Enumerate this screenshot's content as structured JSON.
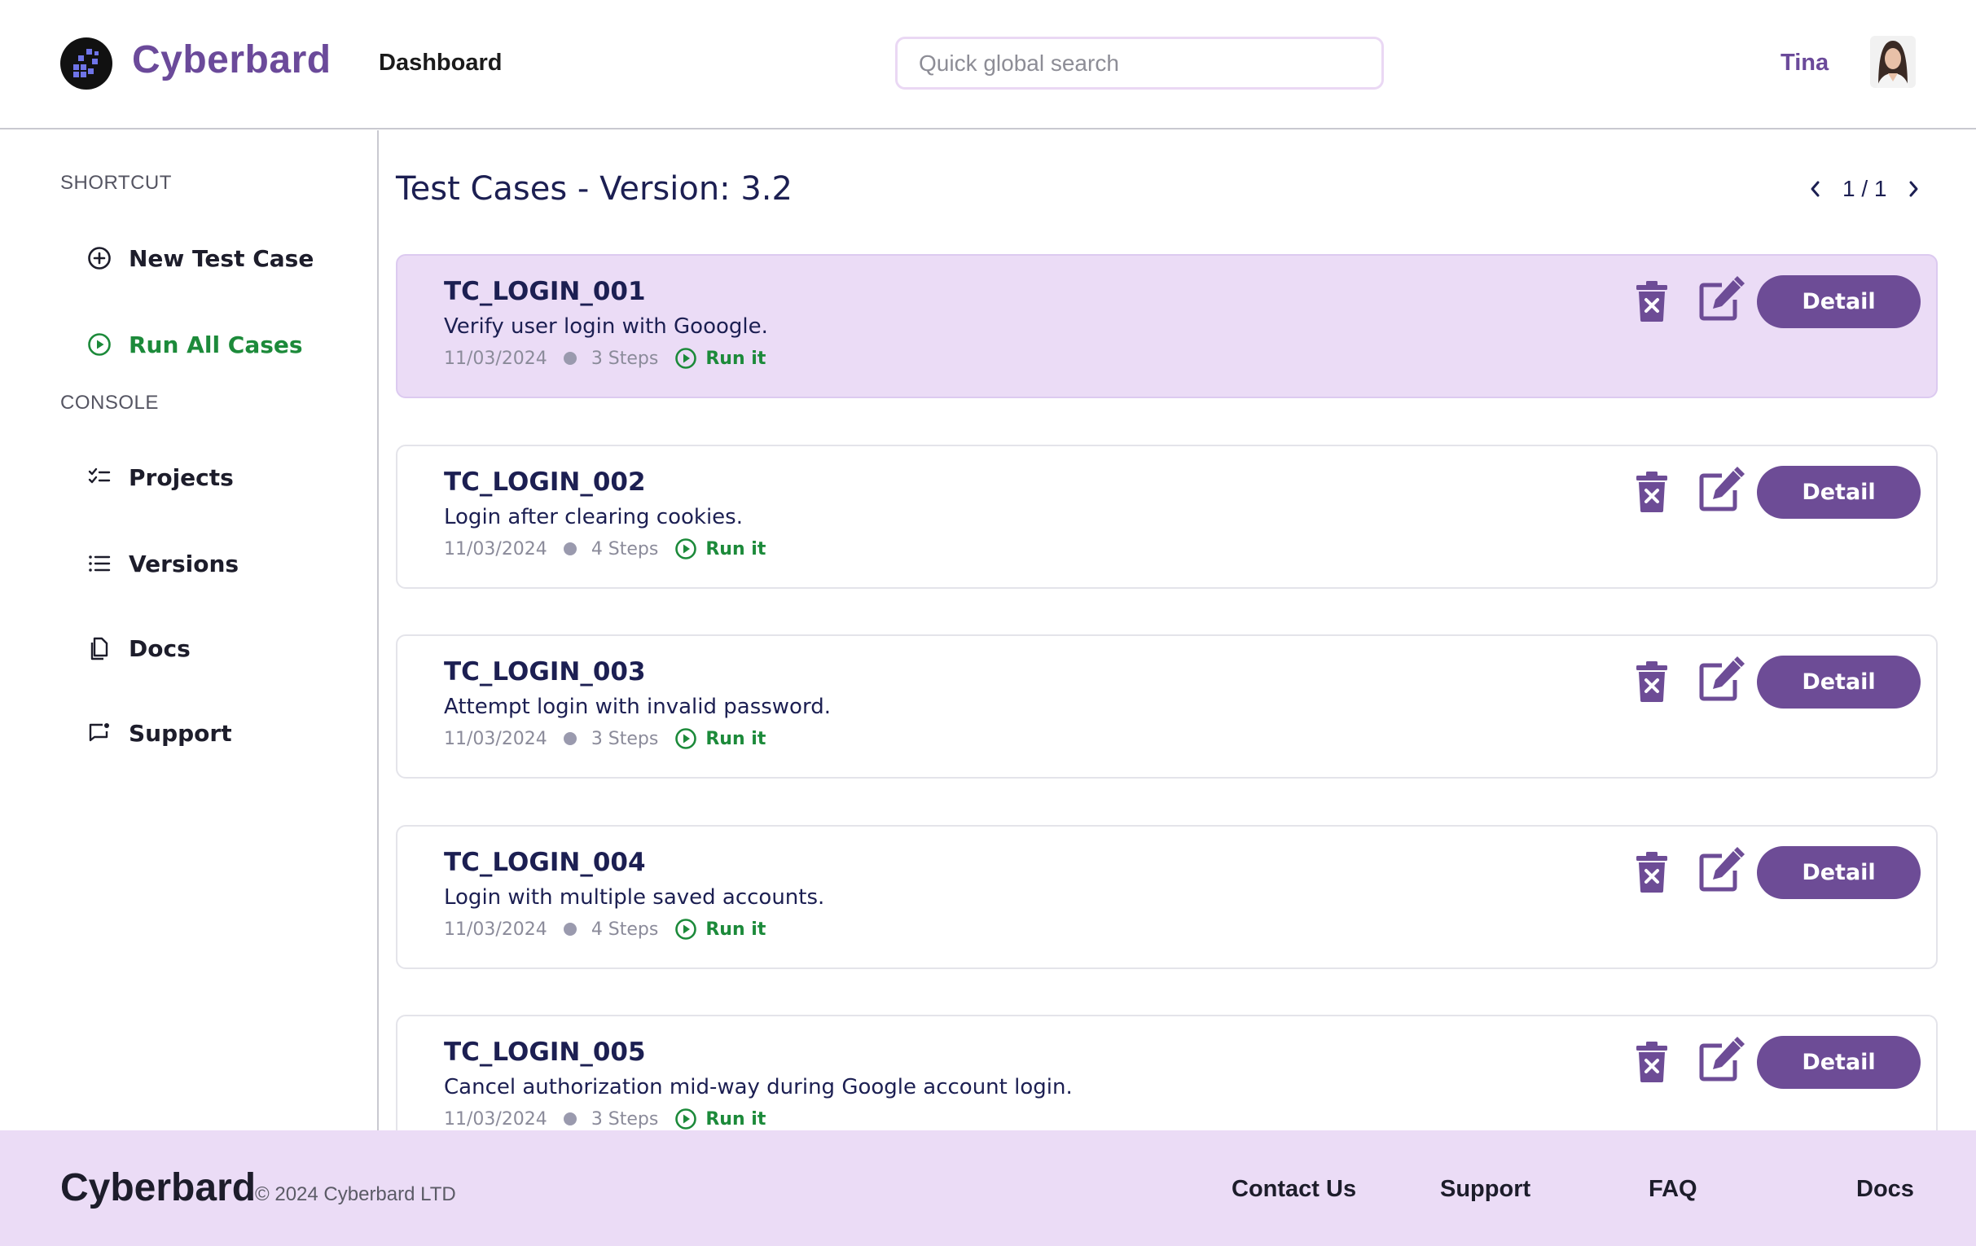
{
  "header": {
    "brand": "Cyberbard",
    "nav_dashboard": "Dashboard",
    "search_placeholder": "Quick global search",
    "user_name": "Tina"
  },
  "sidebar": {
    "shortcut_heading": "SHORTCUT",
    "console_heading": "CONSOLE",
    "items": [
      {
        "label": "New Test Case",
        "icon": "plus-circle-icon"
      },
      {
        "label": "Run All Cases",
        "icon": "play-circle-icon"
      },
      {
        "label": "Projects",
        "icon": "checklist-icon"
      },
      {
        "label": "Versions",
        "icon": "list-icon"
      },
      {
        "label": "Docs",
        "icon": "documents-icon"
      },
      {
        "label": "Support",
        "icon": "chat-notification-icon"
      }
    ]
  },
  "main": {
    "title": "Test Cases - Version: 3.2",
    "pager": "1 / 1",
    "run_label": "Run it",
    "detail_label": "Detail",
    "cases": [
      {
        "id": "TC_LOGIN_001",
        "desc": "Verify user login with Gooogle.",
        "date": "11/03/2024",
        "steps": "3 Steps"
      },
      {
        "id": "TC_LOGIN_002",
        "desc": "Login after clearing cookies.",
        "date": "11/03/2024",
        "steps": "4 Steps"
      },
      {
        "id": "TC_LOGIN_003",
        "desc": "Attempt login with invalid password.",
        "date": "11/03/2024",
        "steps": "3 Steps"
      },
      {
        "id": "TC_LOGIN_004",
        "desc": "Login with multiple saved accounts.",
        "date": "11/03/2024",
        "steps": "4 Steps"
      },
      {
        "id": "TC_LOGIN_005",
        "desc": "Cancel authorization mid-way during Google account login.",
        "date": "11/03/2024",
        "steps": "3 Steps"
      }
    ]
  },
  "footer": {
    "brand": "Cyberbard",
    "copyright": "© 2024 Cyberbard LTD",
    "links": [
      "Contact Us",
      "Support",
      "FAQ",
      "Docs"
    ]
  },
  "colors": {
    "brand_purple": "#6b4a9a",
    "button_purple": "#6d4c96",
    "highlight_lavender": "#ebdcf6",
    "run_green": "#1c8a3a",
    "title_navy": "#1c1f52"
  }
}
